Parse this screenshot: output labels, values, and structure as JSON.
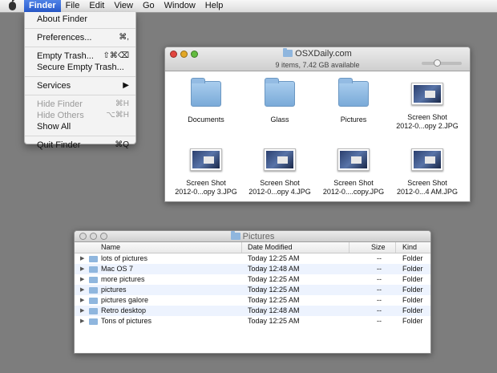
{
  "menubar": {
    "items": [
      "Finder",
      "File",
      "Edit",
      "View",
      "Go",
      "Window",
      "Help"
    ]
  },
  "finder_menu": [
    {
      "label": "About Finder",
      "shortcut": "",
      "disabled": false
    },
    {
      "sep": true
    },
    {
      "label": "Preferences...",
      "shortcut": "⌘,",
      "disabled": false
    },
    {
      "sep": true
    },
    {
      "label": "Empty Trash...",
      "shortcut": "⇧⌘⌫",
      "disabled": false
    },
    {
      "label": "Secure Empty Trash...",
      "shortcut": "",
      "disabled": false
    },
    {
      "sep": true
    },
    {
      "label": "Services",
      "shortcut": "▶",
      "disabled": false
    },
    {
      "sep": true
    },
    {
      "label": "Hide Finder",
      "shortcut": "⌘H",
      "disabled": true
    },
    {
      "label": "Hide Others",
      "shortcut": "⌥⌘H",
      "disabled": true
    },
    {
      "label": "Show All",
      "shortcut": "",
      "disabled": false
    },
    {
      "sep": true
    },
    {
      "label": "Quit Finder",
      "shortcut": "⌘Q",
      "disabled": false
    }
  ],
  "window1": {
    "title": "OSXDaily.com",
    "status": "9 items, 7.42 GB available",
    "items": [
      {
        "type": "folder",
        "label": "Documents"
      },
      {
        "type": "folder",
        "label": "Glass"
      },
      {
        "type": "folder",
        "label": "Pictures"
      },
      {
        "type": "image",
        "label": "Screen Shot\n2012-0...opy 2.JPG"
      },
      {
        "type": "image",
        "label": "Screen Shot\n2012-0...opy 3.JPG"
      },
      {
        "type": "image",
        "label": "Screen Shot\n2012-0...opy 4.JPG"
      },
      {
        "type": "image",
        "label": "Screen Shot\n2012-0....copy.JPG"
      },
      {
        "type": "image",
        "label": "Screen Shot\n2012-0...4 AM.JPG"
      }
    ]
  },
  "window2": {
    "title": "Pictures",
    "columns": {
      "name": "Name",
      "date": "Date Modified",
      "size": "Size",
      "kind": "Kind"
    },
    "rows": [
      {
        "name": "lots of pictures",
        "date": "Today 12:25 AM",
        "size": "--",
        "kind": "Folder"
      },
      {
        "name": "Mac OS 7",
        "date": "Today 12:48 AM",
        "size": "--",
        "kind": "Folder"
      },
      {
        "name": "more pictures",
        "date": "Today 12:25 AM",
        "size": "--",
        "kind": "Folder"
      },
      {
        "name": "pictures",
        "date": "Today 12:25 AM",
        "size": "--",
        "kind": "Folder"
      },
      {
        "name": "pictures galore",
        "date": "Today 12:25 AM",
        "size": "--",
        "kind": "Folder"
      },
      {
        "name": "Retro desktop",
        "date": "Today 12:48 AM",
        "size": "--",
        "kind": "Folder"
      },
      {
        "name": "Tons of pictures",
        "date": "Today 12:25 AM",
        "size": "--",
        "kind": "Folder"
      }
    ]
  },
  "colors": {
    "desktop": "#7d7d7d",
    "menu_highlight": "#2f62d6",
    "close": "#e2463f",
    "minimize": "#e3a826",
    "zoom": "#62bb3f"
  }
}
